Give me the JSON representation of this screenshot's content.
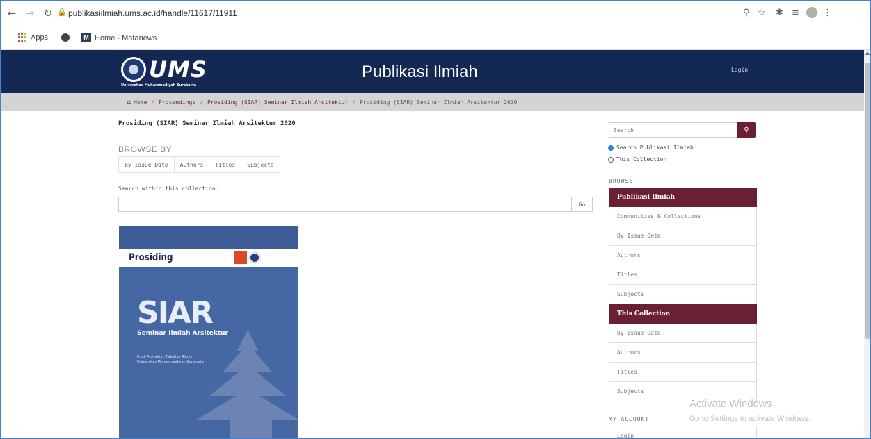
{
  "browser": {
    "url": "publikasiilmiah.ums.ac.id/handle/11617/11911",
    "bookmarks": [
      {
        "label": "Apps"
      },
      {
        "label": ""
      },
      {
        "label": "Home - Matanews"
      }
    ]
  },
  "header": {
    "logo_text": "UMS",
    "logo_sub": "Universitas Muhammadiyah Surakarta",
    "site_title": "Publikasi Ilmiah",
    "login": "Login"
  },
  "breadcrumb": [
    "Home",
    "Proceedings",
    "Prosiding (SIAR) Seminar Ilmiah Arsitektur",
    "Prosiding (SIAR) Seminar Ilmiah Arsitektur 2020"
  ],
  "main": {
    "collection_title": "Prosiding (SIAR) Seminar Ilmiah Arsitektur 2020",
    "browse_by": "BROWSE BY",
    "browse_tabs": [
      "By Issue Date",
      "Authors",
      "Titles",
      "Subjects"
    ],
    "search_within_label": "Search within this collection:",
    "go": "Go",
    "cover": {
      "band_label": "Prosiding",
      "siar": "SIAR",
      "siar_sub": "Seminar Ilmiah Arsitektur",
      "lines": "Prodi Arsitektur, Fakultas Teknik,\nUniversitas Muhammadiyah Surakarta"
    }
  },
  "sidebar": {
    "search_placeholder": "Search",
    "radio_options": [
      "Search Publikasi Ilmiah",
      "This Collection"
    ],
    "browse_heading": "BROWSE",
    "group_publikasi": {
      "head": "Publikasi Ilmiah",
      "items": [
        "Communities & Collections",
        "By Issue Date",
        "Authors",
        "Titles",
        "Subjects"
      ]
    },
    "group_collection": {
      "head": "This Collection",
      "items": [
        "By Issue Date",
        "Authors",
        "Titles",
        "Subjects"
      ]
    },
    "account_heading": "MY ACCOUNT",
    "account_items": [
      "Login"
    ]
  },
  "watermark": {
    "title": "Activate Windows",
    "sub": "Go to Settings to activate Windows."
  },
  "icons": {
    "back": "arrow-left-icon",
    "forward": "arrow-right-icon",
    "reload": "reload-icon",
    "lock": "lock-icon",
    "zoom": "magnifier-icon",
    "star": "star-icon",
    "extensions": "puzzle-icon",
    "menu": "kebab-icon"
  },
  "colors": {
    "header_bg": "#142854",
    "accent": "#6b1f32",
    "breadcrumb_bg": "#d4d4d4"
  }
}
